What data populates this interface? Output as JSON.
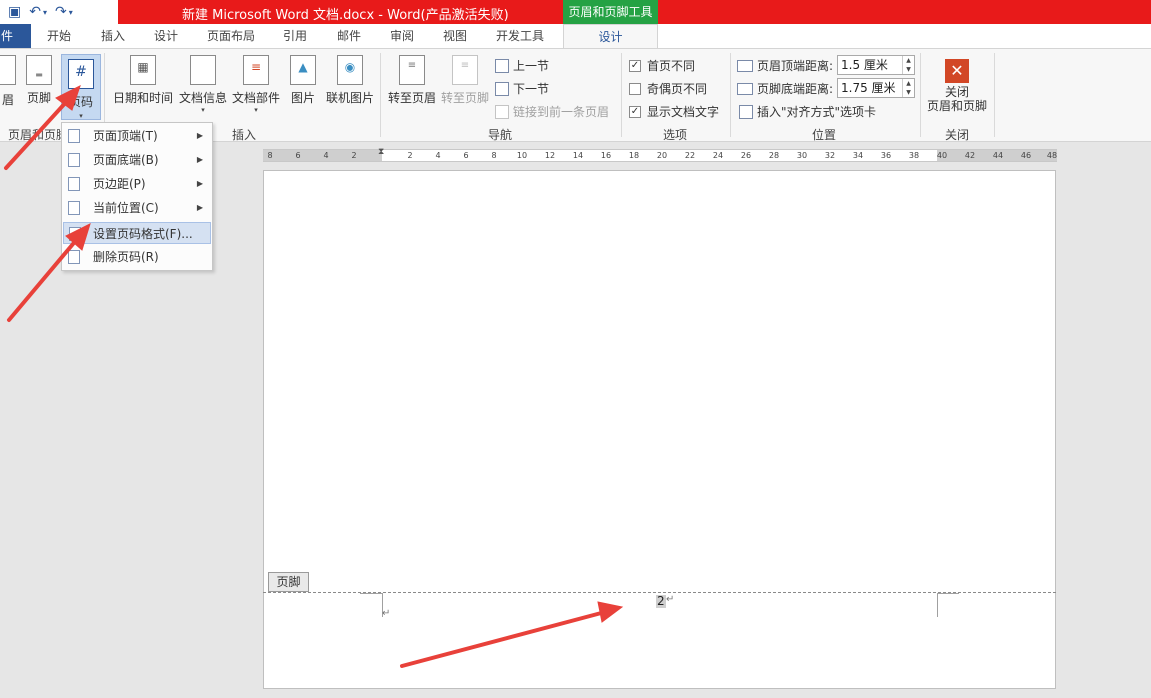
{
  "window": {
    "title": "新建 Microsoft Word 文档.docx -  Word(产品激活失败)",
    "context_tab": "页眉和页脚工具"
  },
  "qat": {
    "save_icon": "save-icon",
    "undo_icon": "undo-icon",
    "redo_icon": "redo-icon"
  },
  "tabs": {
    "file": "件",
    "items": [
      "开始",
      "插入",
      "设计",
      "页面布局",
      "引用",
      "邮件",
      "审阅",
      "视图",
      "开发工具"
    ],
    "active": "设计"
  },
  "ribbon": {
    "header_partial": "眉",
    "footer": "页脚",
    "page_number": "页码",
    "group_header_footer": "页眉和页脚",
    "datetime": "日期和时间",
    "docinfo": "文档信息",
    "quickparts": "文档部件",
    "picture": "图片",
    "online_picture": "联机图片",
    "group_insert": "插入",
    "goto_header": "转至页眉",
    "goto_footer": "转至页脚",
    "prev_section": "上一节",
    "next_section": "下一节",
    "link_previous": "链接到前一条页眉",
    "group_navigation": "导航",
    "diff_first": "首页不同",
    "diff_odd_even": "奇偶页不同",
    "show_doc_text": "显示文档文字",
    "group_options": "选项",
    "header_top_label": "页眉顶端距离:",
    "header_top_value": "1.5 厘米",
    "footer_bottom_label": "页脚底端距离:",
    "footer_bottom_value": "1.75 厘米",
    "insert_align_tab": "插入\"对齐方式\"选项卡",
    "group_position": "位置",
    "close_line1": "关闭",
    "close_line2": "页眉和页脚",
    "group_close": "关闭"
  },
  "menu": {
    "items": [
      {
        "label": "页面顶端(T)",
        "submenu": true
      },
      {
        "label": "页面底端(B)",
        "submenu": true
      },
      {
        "label": "页边距(P)",
        "submenu": true
      },
      {
        "label": "当前位置(C)",
        "submenu": true
      },
      {
        "label": "设置页码格式(F)...",
        "submenu": false,
        "highlighted": true
      },
      {
        "label": "删除页码(R)",
        "submenu": false
      }
    ]
  },
  "ruler": {
    "left_ticks": [
      "8",
      "6",
      "4",
      "2"
    ],
    "right_ticks": [
      "2",
      "4",
      "6",
      "8",
      "10",
      "12",
      "14",
      "16",
      "18",
      "20",
      "22",
      "24",
      "26",
      "28",
      "30",
      "32",
      "34",
      "36",
      "38",
      "40",
      "42",
      "44",
      "46",
      "48"
    ]
  },
  "document": {
    "footer_tag": "页脚",
    "page_number": "2"
  },
  "colors": {
    "title_bar": "#e81a1a",
    "context_tab": "#25a244",
    "file_tab": "#2b579a",
    "annotation_arrow": "#e8413a"
  }
}
